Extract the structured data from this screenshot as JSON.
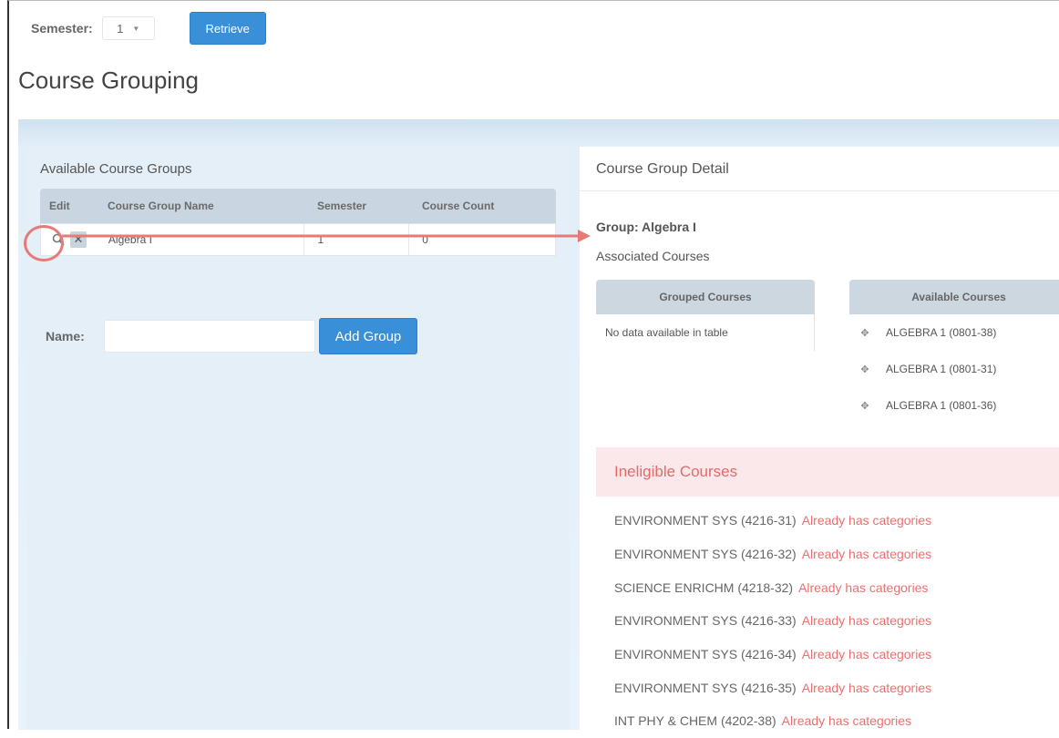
{
  "semester": {
    "label": "Semester:",
    "selected": "1",
    "retrieve_label": "Retrieve"
  },
  "page_title": "Course Grouping",
  "available_groups": {
    "title": "Available Course Groups",
    "columns": [
      "Edit",
      "Course Group Name",
      "Semester",
      "Course Count"
    ],
    "rows": [
      {
        "name": "Algebra I",
        "semester": "1",
        "count": "0"
      }
    ]
  },
  "name_form": {
    "label": "Name:",
    "value": "",
    "add_label": "Add Group"
  },
  "detail": {
    "title": "Course Group Detail",
    "group_label": "Group: Algebra I",
    "associated_label": "Associated Courses",
    "grouped": {
      "header": "Grouped Courses",
      "empty": "No data available in table"
    },
    "available": {
      "header": "Available Courses",
      "items": [
        "ALGEBRA 1 (0801-38)",
        "ALGEBRA 1 (0801-31)",
        "ALGEBRA 1 (0801-36)"
      ]
    },
    "ineligible": {
      "header": "Ineligible Courses",
      "items": [
        {
          "course": "ENVIRONMENT SYS (4216-31)",
          "reason": "Already has categories"
        },
        {
          "course": "ENVIRONMENT SYS (4216-32)",
          "reason": "Already has categories"
        },
        {
          "course": "SCIENCE ENRICHM (4218-32)",
          "reason": "Already has categories"
        },
        {
          "course": "ENVIRONMENT SYS (4216-33)",
          "reason": "Already has categories"
        },
        {
          "course": "ENVIRONMENT SYS (4216-34)",
          "reason": "Already has categories"
        },
        {
          "course": "ENVIRONMENT SYS (4216-35)",
          "reason": "Already has categories"
        },
        {
          "course": "INT PHY & CHEM (4202-38)",
          "reason": "Already has categories"
        }
      ]
    }
  },
  "colors": {
    "accent": "#3a8fd9",
    "highlight": "#e77a76",
    "ineligible": "#ec6f6f"
  }
}
